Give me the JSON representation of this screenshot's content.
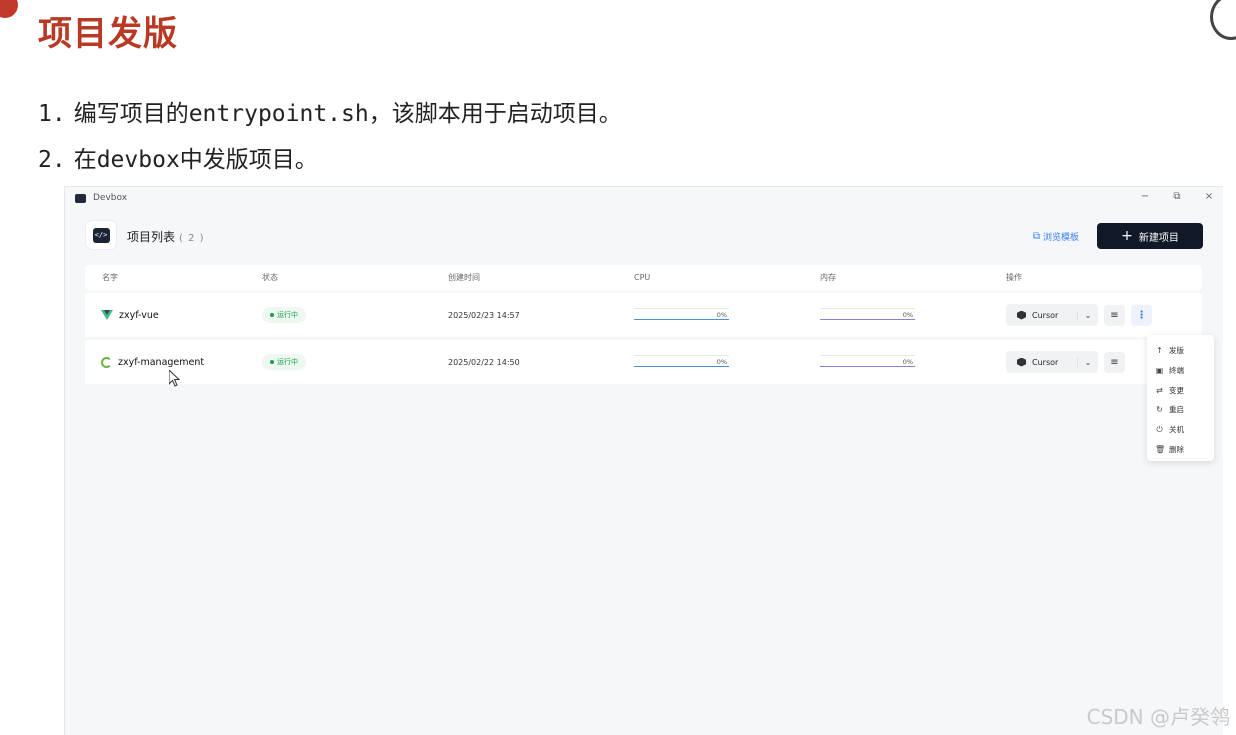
{
  "slide": {
    "title": "项目发版",
    "steps": [
      {
        "num": "1.",
        "text": "编写项目的entrypoint.sh，该脚本用于启动项目。"
      },
      {
        "num": "2.",
        "text": "在devbox中发版项目。"
      }
    ],
    "watermark": "CSDN @卢癸鸰"
  },
  "window": {
    "title": "Devbox",
    "controls": {
      "minimize": "−",
      "restore": "⧉",
      "close": "×"
    }
  },
  "header": {
    "logo": "</>",
    "list_title": "项目列表",
    "list_count": "( 2 )",
    "browse_label": "浏览模板",
    "new_button": "新建项目"
  },
  "table": {
    "columns": [
      "名字",
      "状态",
      "创建时间",
      "CPU",
      "内存",
      "操作"
    ],
    "rows": [
      {
        "name": "zxyf-vue",
        "icon": "vue-icon",
        "status": "运行中",
        "created": "2025/02/23 14:57",
        "cpu": "0%",
        "mem": "0%",
        "ide": "Cursor"
      },
      {
        "name": "zxyf-management",
        "icon": "spring-icon",
        "status": "运行中",
        "created": "2025/02/22 14:50",
        "cpu": "0%",
        "mem": "0%",
        "ide": "Cursor"
      }
    ]
  },
  "menu": {
    "items": [
      {
        "icon": "↑",
        "label": "发版"
      },
      {
        "icon": "▣",
        "label": "终端"
      },
      {
        "icon": "⇄",
        "label": "变更"
      },
      {
        "icon": "↻",
        "label": "重启"
      },
      {
        "icon": "⏻",
        "label": "关机"
      },
      {
        "icon": "🗑",
        "label": "删除"
      }
    ]
  },
  "colors": {
    "title_red": "#b83a25",
    "primary_dark": "#111827",
    "running_green": "#16a34a",
    "link_blue": "#3b82f6"
  }
}
